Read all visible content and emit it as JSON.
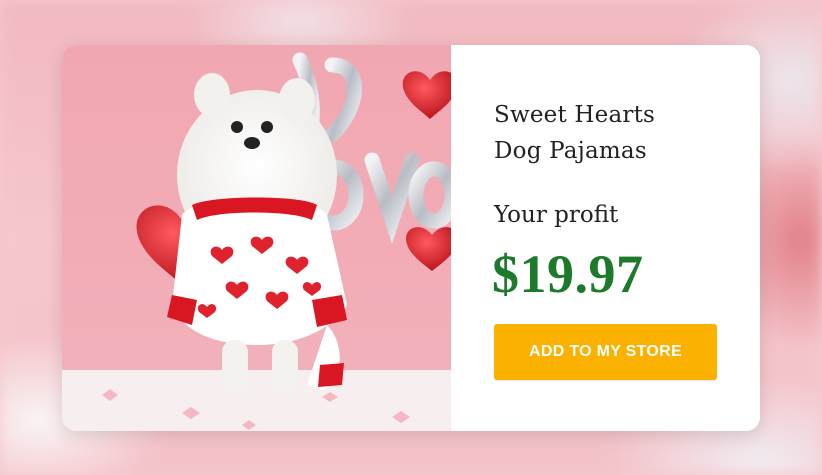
{
  "product": {
    "title_line1": "Sweet Hearts",
    "title_line2": "Dog Pajamas",
    "image_alt": "White Pomeranian wearing red heart-print pajamas in front of a love balloon"
  },
  "profit": {
    "label": "Your profit",
    "amount": "$19.97"
  },
  "actions": {
    "add_label": "ADD TO MY STORE"
  },
  "colors": {
    "price_green": "#1c7a2a",
    "button_orange": "#fbb100",
    "photo_pink": "#f1a7b1"
  }
}
